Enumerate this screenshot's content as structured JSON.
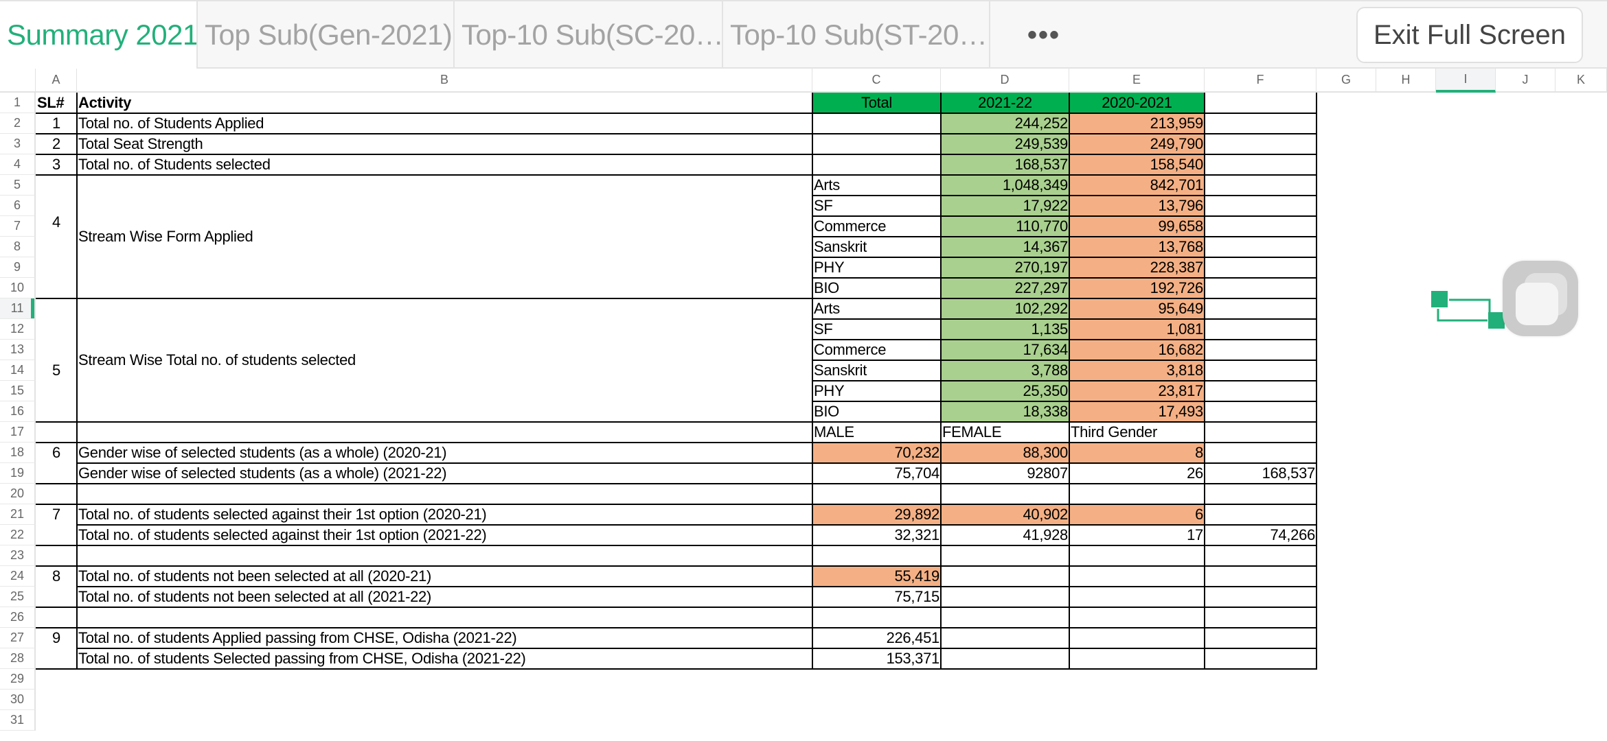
{
  "tabs": [
    {
      "label": "Summary 2021",
      "active": true
    },
    {
      "label": "Top Sub(Gen-2021)",
      "active": false
    },
    {
      "label": "Top-10 Sub(SC-20…",
      "active": false
    },
    {
      "label": "Top-10 Sub(ST-20…",
      "active": false
    }
  ],
  "more_label": "•••",
  "exit_button": "Exit Full Screen",
  "columns": [
    "A",
    "B",
    "C",
    "D",
    "E",
    "F",
    "G",
    "H",
    "I",
    "J",
    "K"
  ],
  "selected_column": "I",
  "selected_row": "11",
  "row_numbers": [
    "1",
    "2",
    "3",
    "4",
    "5",
    "6",
    "7",
    "8",
    "9",
    "10",
    "11",
    "12",
    "13",
    "14",
    "15",
    "16",
    "17",
    "18",
    "19",
    "20",
    "21",
    "22",
    "23",
    "24",
    "25",
    "26",
    "27",
    "28",
    "29",
    "30",
    "31"
  ],
  "colors": {
    "accent": "#22b07a",
    "header_green": "#00b050",
    "light_green": "#a9d08e",
    "orange": "#f4b084"
  },
  "sheet": {
    "header": {
      "sl": "SL#",
      "activity": "Activity",
      "total": "Total",
      "y2122": "2021-22",
      "y2021": "2020-2021"
    },
    "r2": {
      "sl": "1",
      "activity": "Total no. of Students Applied",
      "d": "244,252",
      "e": "213,959"
    },
    "r3": {
      "sl": "2",
      "activity": "Total Seat Strength",
      "d": "249,539",
      "e": "249,790"
    },
    "r4": {
      "sl": "3",
      "activity": "Total no. of Students selected",
      "d": "168,537",
      "e": "158,540"
    },
    "g4": {
      "sl": "4",
      "activity": "Stream Wise Form Applied"
    },
    "stream_applied": [
      {
        "stream": "Arts",
        "d": "1,048,349",
        "e": "842,701"
      },
      {
        "stream": "SF",
        "d": "17,922",
        "e": "13,796"
      },
      {
        "stream": "Commerce",
        "d": "110,770",
        "e": "99,658"
      },
      {
        "stream": "Sanskrit",
        "d": "14,367",
        "e": "13,768"
      },
      {
        "stream": "PHY",
        "d": "270,197",
        "e": "228,387"
      },
      {
        "stream": "BIO",
        "d": "227,297",
        "e": "192,726"
      }
    ],
    "g5": {
      "sl": "5",
      "activity": "Stream Wise Total no. of students selected"
    },
    "stream_selected": [
      {
        "stream": "Arts",
        "d": "102,292",
        "e": "95,649"
      },
      {
        "stream": "SF",
        "d": "1,135",
        "e": "1,081"
      },
      {
        "stream": "Commerce",
        "d": "17,634",
        "e": "16,682"
      },
      {
        "stream": "Sanskrit",
        "d": "3,788",
        "e": "3,818"
      },
      {
        "stream": "PHY",
        "d": "25,350",
        "e": "23,817"
      },
      {
        "stream": "BIO",
        "d": "18,338",
        "e": "17,493"
      }
    ],
    "r17": {
      "c": "MALE",
      "d": "FEMALE",
      "e": "Third Gender"
    },
    "r18": {
      "sl": "6",
      "activity": "Gender wise of selected students (as a whole) (2020-21)",
      "c": "70,232",
      "d": "88,300",
      "e": "8"
    },
    "r19": {
      "activity": "Gender wise of selected students (as a whole) (2021-22)",
      "c": "75,704",
      "d": "92807",
      "e": "26",
      "f": "168,537"
    },
    "r21": {
      "sl": "7",
      "activity": "Total no. of students selected against their 1st option (2020-21)",
      "c": "29,892",
      "d": "40,902",
      "e": "6"
    },
    "r22": {
      "activity": "Total no. of students selected against their 1st option (2021-22)",
      "c": "32,321",
      "d": "41,928",
      "e": "17",
      "f": "74,266"
    },
    "r24": {
      "sl": "8",
      "activity": "Total no. of students not been selected at all (2020-21)",
      "c": "55,419"
    },
    "r25": {
      "activity": "Total no. of students not been selected at all (2021-22)",
      "c": "75,715"
    },
    "r27": {
      "sl": "9",
      "activity": "Total no. of students Applied passing from CHSE, Odisha (2021-22)",
      "c": "226,451"
    },
    "r28": {
      "activity": "Total no. of students Selected passing from CHSE, Odisha (2021-22)",
      "c": "153,371"
    }
  }
}
